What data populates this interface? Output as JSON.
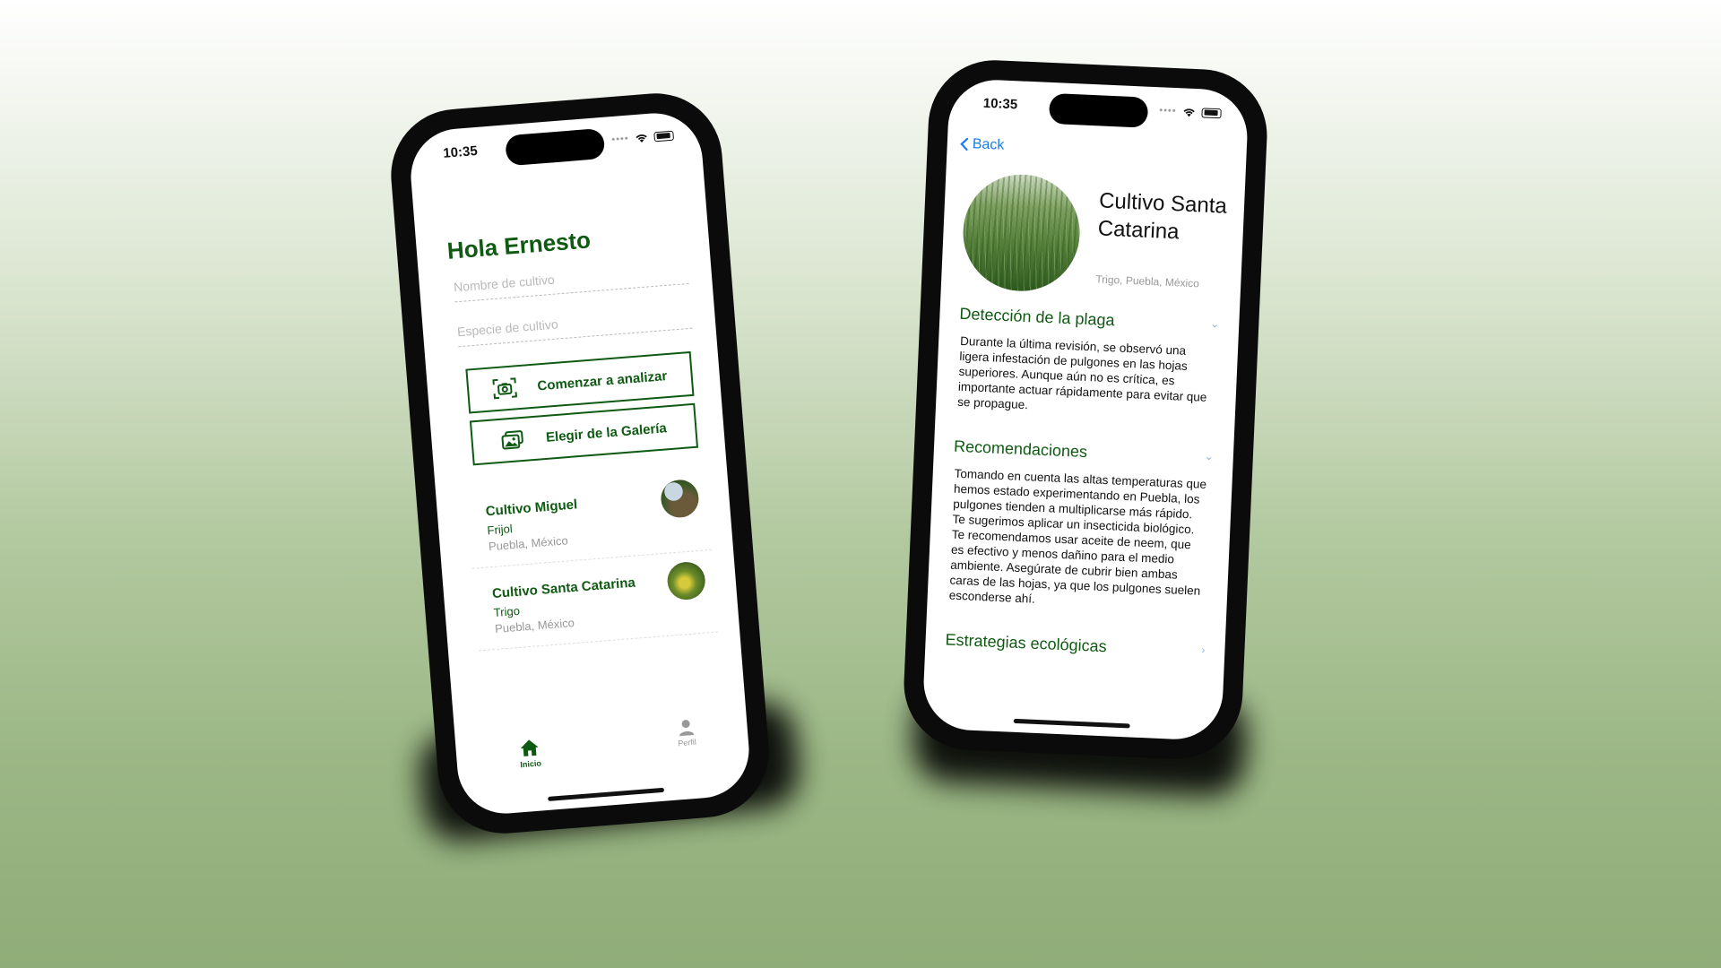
{
  "home_screen": {
    "status": {
      "time": "10:35",
      "signal": "••••"
    },
    "greeting": "Hola Ernesto",
    "crop_name_placeholder": "Nombre de cultivo",
    "crop_species_placeholder": "Especie de cultivo",
    "analyze_button": "Comenzar a analizar",
    "gallery_button": "Elegir de la Galería",
    "crops": [
      {
        "title": "Cultivo Miguel",
        "species": "Frijol",
        "location": "Puebla, México"
      },
      {
        "title": "Cultivo Santa Catarina",
        "species": "Trigo",
        "location": "Puebla, México"
      }
    ],
    "tabs": {
      "home": "Inicio",
      "profile": "Perfil"
    }
  },
  "detail_screen": {
    "status": {
      "time": "10:35",
      "signal": "••••"
    },
    "back_label": "Back",
    "title": "Cultivo Santa Catarina",
    "subtitle": "Trigo, Puebla, México",
    "sections": [
      {
        "heading": "Detección de la plaga",
        "body": "Durante la última revisión, se observó una ligera infestación de pulgones en las hojas superiores. Aunque aún no es crítica, es importante actuar rápidamente para evitar que se propague."
      },
      {
        "heading": "Recomendaciones",
        "body": "Tomando en cuenta las altas temperaturas que hemos estado experimentando en Puebla, los pulgones tienden a multiplicarse más rápido. Te sugerimos aplicar un insecticida biológico. Te recomendamos usar aceite de neem, que es efectivo y menos dañino para el medio ambiente. Asegúrate de cubrir bien ambas caras de las hojas, ya que los pulgones suelen esconderse ahí."
      },
      {
        "heading": "Estrategias ecológicas"
      }
    ]
  },
  "colors": {
    "brand_green": "#0f5a12",
    "link_blue": "#1a7cf0"
  },
  "icons": [
    "camera-icon",
    "gallery-icon",
    "home-icon",
    "profile-icon",
    "back-chevron-icon",
    "chevron-down-icon",
    "chevron-right-icon",
    "wifi-icon",
    "battery-icon"
  ]
}
